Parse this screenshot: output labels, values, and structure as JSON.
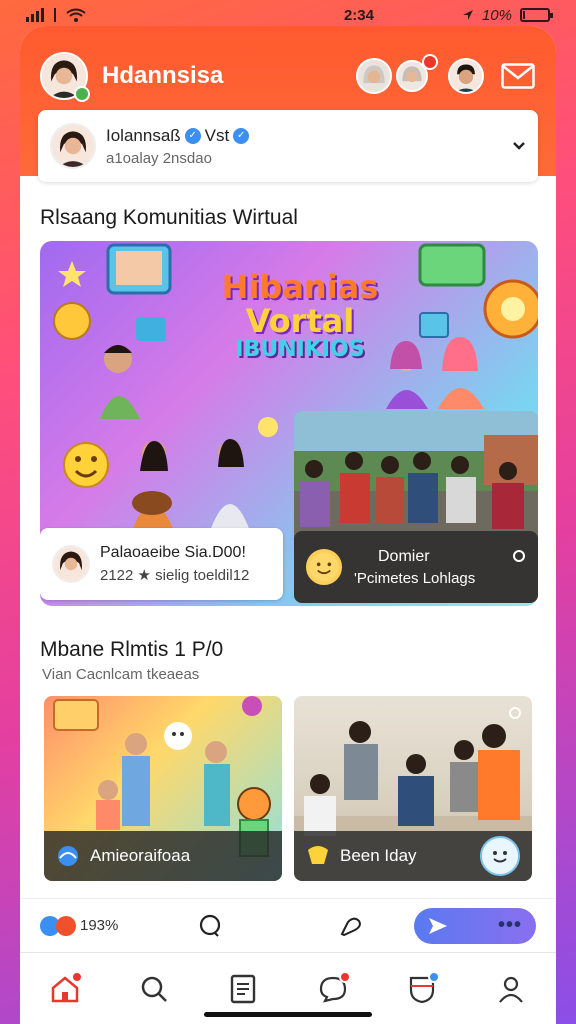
{
  "status_bar": {
    "time": "2:34",
    "battery_text": "10%",
    "battery_level": 0.1
  },
  "header": {
    "app_title": "Hdannsisa"
  },
  "profile": {
    "name": "Iolannsaß",
    "name_extra": "Vst",
    "sub": "a1oalay 2nsdao"
  },
  "section1": {
    "title": "Rlsaang Komunitias Wirtual"
  },
  "hero": {
    "title_line1": "Hibanias",
    "title_line2": "Vortal",
    "title_line3": "IBUNIKIOS",
    "caption_title": "Palaoaeibe Sia.D00!",
    "caption_sub": "2122 ★ sielig toeldil12"
  },
  "photo_card": {
    "caption_title": "Domier",
    "caption_sub": "'Pcimetes Lohlags"
  },
  "section2": {
    "title": "Mbane Rlmtis 1 P/0",
    "sub": "Vian Cacnlcam tkeaeas"
  },
  "grid": [
    {
      "label": "Amieoraifoaa"
    },
    {
      "label": "Been Iday"
    }
  ],
  "action_bar": {
    "reaction_count": "193%"
  },
  "colors": {
    "accent": "#ff5a2f",
    "pill": "#6a76f0",
    "badge": "#e8382e",
    "verified": "#3a8ff0"
  }
}
